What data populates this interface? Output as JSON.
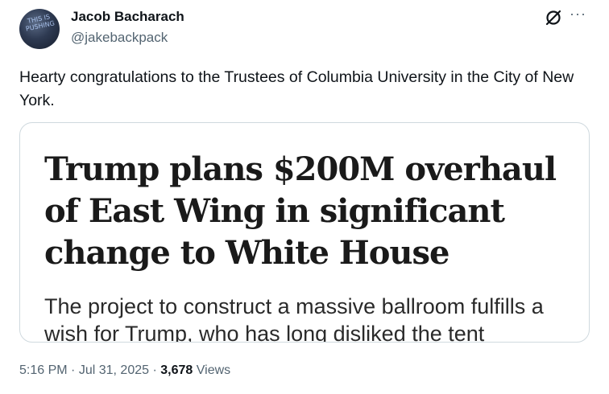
{
  "author": {
    "name": "Jacob Bacharach",
    "handle": "@jakebackpack",
    "avatar_text": "THIS IS PUSHING"
  },
  "icons": {
    "grok": "grok-icon",
    "more": "more-icon"
  },
  "tweet": {
    "text": "Hearty congratulations to the Trustees of Columbia University in the City of New York."
  },
  "card": {
    "headline": "Trump plans $200M overhaul of East Wing in significant change to White House",
    "subhead": "The project to construct a massive ballroom fulfills a wish for Trump, who has long disliked the tent"
  },
  "meta": {
    "time": "5:16 PM",
    "separator": "·",
    "date": "Jul 31, 2025",
    "views_count": "3,678",
    "views_label": "Views"
  }
}
